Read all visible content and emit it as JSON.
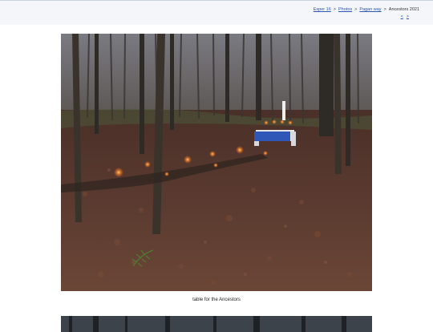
{
  "breadcrumb": {
    "items": [
      {
        "label": "Esper 16"
      },
      {
        "label": "Photos"
      },
      {
        "label": "Pagan way"
      }
    ],
    "separator": ">",
    "current": "Ancestors 2021"
  },
  "pager": {
    "prev": "<",
    "next": ">"
  },
  "photo": {
    "caption": "table for the Ancestors"
  },
  "colors": {
    "link": "#2a55b0",
    "topbar_bg": "#f4f6f9"
  }
}
